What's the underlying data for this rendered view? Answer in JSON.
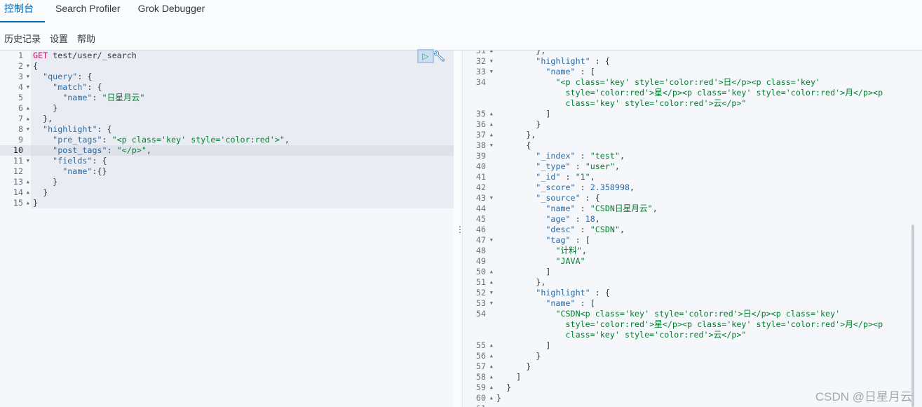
{
  "tabs": [
    {
      "label": "控制台",
      "active": true
    },
    {
      "label": "Search Profiler"
    },
    {
      "label": "Grok Debugger"
    }
  ],
  "menu": [
    "历史记录",
    "设置",
    "帮助"
  ],
  "colors": {
    "accent": "#006bb8",
    "key": "#2b6aa3",
    "string": "#017d2d",
    "method": "#c8106b"
  },
  "actions": {
    "run_icon": "play-icon",
    "settings_icon": "wrench-icon"
  },
  "request": {
    "active_line": 10,
    "lines": [
      {
        "n": 1,
        "t": [
          [
            "m",
            "GET"
          ],
          [
            "u",
            " test/user/_search"
          ]
        ]
      },
      {
        "n": 2,
        "f": "down",
        "t": [
          [
            "p",
            "{"
          ]
        ]
      },
      {
        "n": 3,
        "f": "down",
        "t": [
          [
            "p",
            "  "
          ],
          [
            "k",
            "\"query\""
          ],
          [
            "p",
            ": {"
          ]
        ]
      },
      {
        "n": 4,
        "f": "down",
        "t": [
          [
            "p",
            "    "
          ],
          [
            "k",
            "\"match\""
          ],
          [
            "p",
            ": {"
          ]
        ]
      },
      {
        "n": 5,
        "t": [
          [
            "p",
            "      "
          ],
          [
            "k",
            "\"name\""
          ],
          [
            "p",
            ": "
          ],
          [
            "s",
            "\"日星月云\""
          ]
        ]
      },
      {
        "n": 6,
        "f": "up",
        "t": [
          [
            "p",
            "    }"
          ]
        ]
      },
      {
        "n": 7,
        "f": "up",
        "t": [
          [
            "p",
            "  },"
          ]
        ]
      },
      {
        "n": 8,
        "f": "down",
        "t": [
          [
            "p",
            "  "
          ],
          [
            "k",
            "\"highlight\""
          ],
          [
            "p",
            ": {"
          ]
        ]
      },
      {
        "n": 9,
        "t": [
          [
            "p",
            "    "
          ],
          [
            "k",
            "\"pre_tags\""
          ],
          [
            "p",
            ": "
          ],
          [
            "s",
            "\"<p class='key' style='color:red'>\""
          ],
          [
            "p",
            ","
          ]
        ]
      },
      {
        "n": 10,
        "t": [
          [
            "p",
            "    "
          ],
          [
            "k",
            "\"post_tags\""
          ],
          [
            "p",
            ": "
          ],
          [
            "s",
            "\"</p>\""
          ],
          [
            "p",
            ","
          ]
        ]
      },
      {
        "n": 11,
        "f": "down",
        "t": [
          [
            "p",
            "    "
          ],
          [
            "k",
            "\"fields\""
          ],
          [
            "p",
            ": {"
          ]
        ]
      },
      {
        "n": 12,
        "t": [
          [
            "p",
            "      "
          ],
          [
            "k",
            "\"name\""
          ],
          [
            "p",
            ":{}"
          ]
        ]
      },
      {
        "n": 13,
        "f": "up",
        "t": [
          [
            "p",
            "    }"
          ]
        ]
      },
      {
        "n": 14,
        "f": "up",
        "t": [
          [
            "p",
            "  }"
          ]
        ]
      },
      {
        "n": 15,
        "f": "up",
        "t": [
          [
            "p",
            "}"
          ]
        ]
      }
    ]
  },
  "response": {
    "lines": [
      {
        "n": 31,
        "f": "up",
        "t": [
          [
            "p",
            "        },"
          ]
        ]
      },
      {
        "n": 32,
        "f": "down",
        "t": [
          [
            "p",
            "        "
          ],
          [
            "k",
            "\"highlight\""
          ],
          [
            "p",
            " : {"
          ]
        ]
      },
      {
        "n": 33,
        "f": "down",
        "t": [
          [
            "p",
            "          "
          ],
          [
            "k",
            "\"name\""
          ],
          [
            "p",
            " : ["
          ]
        ]
      },
      {
        "n": 34,
        "t": [
          [
            "p",
            "            "
          ],
          [
            "s",
            "\"<p class='key' style='color:red'>日</p><p class='key' style='color:red'>星</p><p class='key' style='color:red'>月</p><p class='key' style='color:red'>云</p>\""
          ]
        ]
      },
      {
        "n": 35,
        "f": "up",
        "t": [
          [
            "p",
            "          ]"
          ]
        ]
      },
      {
        "n": 36,
        "f": "up",
        "t": [
          [
            "p",
            "        }"
          ]
        ]
      },
      {
        "n": 37,
        "f": "up",
        "t": [
          [
            "p",
            "      },"
          ]
        ]
      },
      {
        "n": 38,
        "f": "down",
        "t": [
          [
            "p",
            "      {"
          ]
        ]
      },
      {
        "n": 39,
        "t": [
          [
            "p",
            "        "
          ],
          [
            "k",
            "\"_index\""
          ],
          [
            "p",
            " : "
          ],
          [
            "s",
            "\"test\""
          ],
          [
            "p",
            ","
          ]
        ]
      },
      {
        "n": 40,
        "t": [
          [
            "p",
            "        "
          ],
          [
            "k",
            "\"_type\""
          ],
          [
            "p",
            " : "
          ],
          [
            "s",
            "\"user\""
          ],
          [
            "p",
            ","
          ]
        ]
      },
      {
        "n": 41,
        "t": [
          [
            "p",
            "        "
          ],
          [
            "k",
            "\"_id\""
          ],
          [
            "p",
            " : "
          ],
          [
            "s",
            "\"1\""
          ],
          [
            "p",
            ","
          ]
        ]
      },
      {
        "n": 42,
        "t": [
          [
            "p",
            "        "
          ],
          [
            "k",
            "\"_score\""
          ],
          [
            "p",
            " : "
          ],
          [
            "n",
            "2.358998"
          ],
          [
            "p",
            ","
          ]
        ]
      },
      {
        "n": 43,
        "f": "down",
        "t": [
          [
            "p",
            "        "
          ],
          [
            "k",
            "\"_source\""
          ],
          [
            "p",
            " : {"
          ]
        ]
      },
      {
        "n": 44,
        "t": [
          [
            "p",
            "          "
          ],
          [
            "k",
            "\"name\""
          ],
          [
            "p",
            " : "
          ],
          [
            "s",
            "\"CSDN日星月云\""
          ],
          [
            "p",
            ","
          ]
        ]
      },
      {
        "n": 45,
        "t": [
          [
            "p",
            "          "
          ],
          [
            "k",
            "\"age\""
          ],
          [
            "p",
            " : "
          ],
          [
            "n",
            "18"
          ],
          [
            "p",
            ","
          ]
        ]
      },
      {
        "n": 46,
        "t": [
          [
            "p",
            "          "
          ],
          [
            "k",
            "\"desc\""
          ],
          [
            "p",
            " : "
          ],
          [
            "s",
            "\"CSDN\""
          ],
          [
            "p",
            ","
          ]
        ]
      },
      {
        "n": 47,
        "f": "down",
        "t": [
          [
            "p",
            "          "
          ],
          [
            "k",
            "\"tag\""
          ],
          [
            "p",
            " : ["
          ]
        ]
      },
      {
        "n": 48,
        "t": [
          [
            "p",
            "            "
          ],
          [
            "s",
            "\"计料\""
          ],
          [
            "p",
            ","
          ]
        ]
      },
      {
        "n": 49,
        "t": [
          [
            "p",
            "            "
          ],
          [
            "s",
            "\"JAVA\""
          ]
        ]
      },
      {
        "n": 50,
        "f": "up",
        "t": [
          [
            "p",
            "          ]"
          ]
        ]
      },
      {
        "n": 51,
        "f": "up",
        "t": [
          [
            "p",
            "        },"
          ]
        ]
      },
      {
        "n": 52,
        "f": "down",
        "t": [
          [
            "p",
            "        "
          ],
          [
            "k",
            "\"highlight\""
          ],
          [
            "p",
            " : {"
          ]
        ]
      },
      {
        "n": 53,
        "f": "down",
        "t": [
          [
            "p",
            "          "
          ],
          [
            "k",
            "\"name\""
          ],
          [
            "p",
            " : ["
          ]
        ]
      },
      {
        "n": 54,
        "t": [
          [
            "p",
            "            "
          ],
          [
            "s",
            "\"CSDN<p class='key' style='color:red'>日</p><p class='key' style='color:red'>星</p><p class='key' style='color:red'>月</p><p class='key' style='color:red'>云</p>\""
          ]
        ]
      },
      {
        "n": 55,
        "f": "up",
        "t": [
          [
            "p",
            "          ]"
          ]
        ]
      },
      {
        "n": 56,
        "f": "up",
        "t": [
          [
            "p",
            "        }"
          ]
        ]
      },
      {
        "n": 57,
        "f": "up",
        "t": [
          [
            "p",
            "      }"
          ]
        ]
      },
      {
        "n": 58,
        "f": "up",
        "t": [
          [
            "p",
            "    ]"
          ]
        ]
      },
      {
        "n": 59,
        "f": "up",
        "t": [
          [
            "p",
            "  }"
          ]
        ]
      },
      {
        "n": 60,
        "f": "up",
        "t": [
          [
            "p",
            "}"
          ]
        ]
      },
      {
        "n": 61,
        "t": []
      }
    ]
  },
  "watermark": "CSDN @日星月云"
}
